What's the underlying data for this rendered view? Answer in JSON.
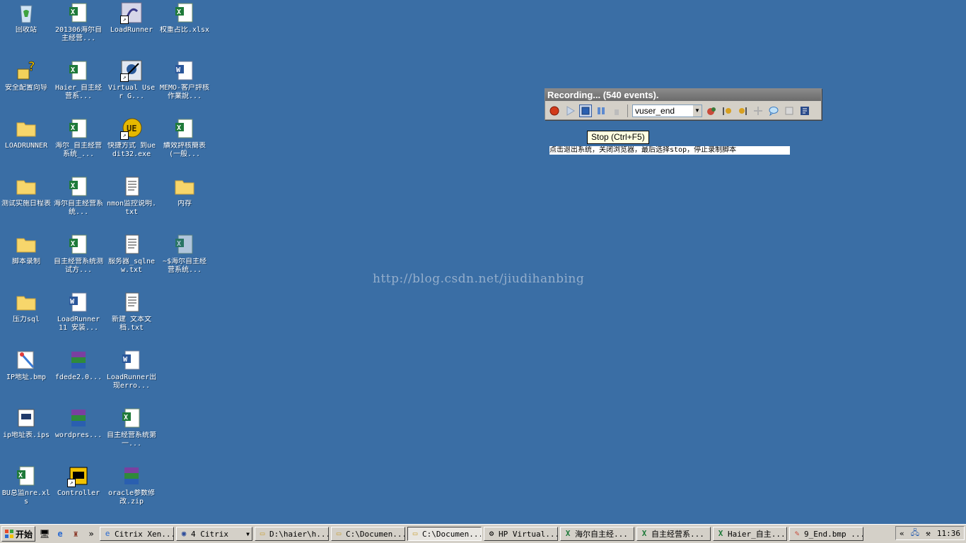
{
  "desktop": {
    "icons": [
      {
        "label": "回收站",
        "kind": "recycle-bin-icon"
      },
      {
        "label": "安全配置向导",
        "kind": "security-wizard-icon"
      },
      {
        "label": "LOADRUNNER",
        "kind": "folder-icon"
      },
      {
        "label": "测试实施日程表",
        "kind": "folder-icon"
      },
      {
        "label": "脚本录制",
        "kind": "folder-icon"
      },
      {
        "label": "压力sql",
        "kind": "folder-icon"
      },
      {
        "label": "IP地址.bmp",
        "kind": "paint-icon"
      },
      {
        "label": "ip地址表.ips",
        "kind": "document-icon"
      },
      {
        "label": "BU总监nre.xls",
        "kind": "excel-icon"
      },
      {
        "label": "201306海尔自主经营...",
        "kind": "excel-icon"
      },
      {
        "label": "Haier_自主经营系...",
        "kind": "excel-icon"
      },
      {
        "label": "海尔_自主经营系统_...",
        "kind": "excel-icon"
      },
      {
        "label": "海尔自主经营系统...",
        "kind": "excel-icon"
      },
      {
        "label": "自主经营系统测试方...",
        "kind": "excel-icon"
      },
      {
        "label": "LoadRunner 11 安装...",
        "kind": "word-icon"
      },
      {
        "label": "fdede2.0...",
        "kind": "winrar-icon"
      },
      {
        "label": "wordpres...",
        "kind": "winrar-icon"
      },
      {
        "label": "Controller",
        "kind": "controller-icon"
      },
      {
        "label": "LoadRunner",
        "kind": "loadrunner-icon"
      },
      {
        "label": "Virtual User G...",
        "kind": "vugen-icon"
      },
      {
        "label": "快捷方式 到uedit32.exe",
        "kind": "ultraedit-icon"
      },
      {
        "label": "nmon监控说明.txt",
        "kind": "text-file-icon"
      },
      {
        "label": "服务器_sqlnew.txt",
        "kind": "text-file-icon"
      },
      {
        "label": "新建 文本文档.txt",
        "kind": "text-file-icon"
      },
      {
        "label": "LoadRunner出现erro...",
        "kind": "word-icon"
      },
      {
        "label": "自主经营系统第一...",
        "kind": "excel-icon"
      },
      {
        "label": "oracle参数修改.zip",
        "kind": "winrar-icon"
      },
      {
        "label": "权重占比.xlsx",
        "kind": "excel-icon"
      },
      {
        "label": "MEMO-客户評核作業說...",
        "kind": "word-icon"
      },
      {
        "label": "績效評核簡表(一般...",
        "kind": "excel-icon"
      },
      {
        "label": "内存",
        "kind": "folder-icon"
      },
      {
        "label": "~$海尔自主经营系统...",
        "kind": "excel-icon"
      }
    ]
  },
  "recorder": {
    "title": "Recording... (540 events).",
    "action_value": "vuser_end",
    "tooltip": "Stop (Ctrl+F5)"
  },
  "note": "点击退出系统，关闭浏览器，最后选择stop，停止录制脚本",
  "watermark": "http://blog.csdn.net/jiudihanbing",
  "taskbar": {
    "start_label": "开始",
    "overflow": "»",
    "tasks": [
      {
        "label": "Citrix Xen..."
      },
      {
        "label": "4 Citrix"
      },
      {
        "label": "D:\\haier\\h..."
      },
      {
        "label": "C:\\Documen..."
      },
      {
        "label": "C:\\Documen..."
      },
      {
        "label": "HP Virtual..."
      },
      {
        "label": "海尔自主经..."
      },
      {
        "label": "自主经营系..."
      },
      {
        "label": "Haier_自主..."
      },
      {
        "label": "9_End.bmp ..."
      }
    ],
    "tray_chevron": "«",
    "clock": "11:36"
  }
}
